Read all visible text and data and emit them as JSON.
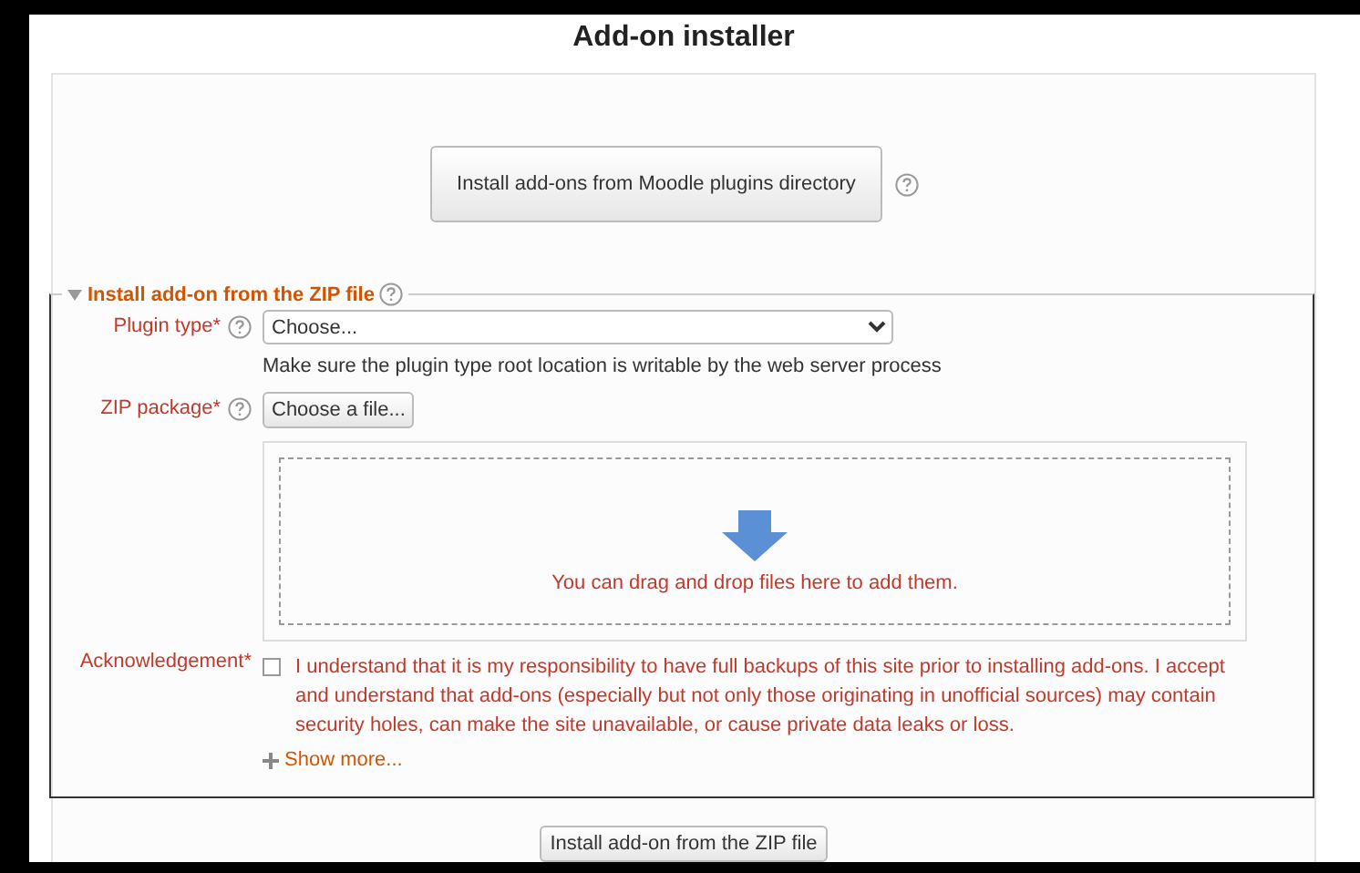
{
  "page": {
    "title": "Add-on installer"
  },
  "directory_button": {
    "label": "Install add-ons from Moodle plugins directory"
  },
  "zip_section": {
    "legend": "Install add-on from the ZIP file",
    "expanded": true,
    "plugin_type": {
      "label": "Plugin type",
      "required": "*",
      "value": "Choose...",
      "hint": "Make sure the plugin type root location is writable by the web server process"
    },
    "zip_package": {
      "label": "ZIP package",
      "required": "*",
      "button": "Choose a file...",
      "drop_text": "You can drag and drop files here to add them."
    },
    "acknowledgement": {
      "label": "Acknowledgement",
      "required": "*",
      "checked": false,
      "text": "I understand that it is my responsibility to have full backups of this site prior to installing add-ons. I accept and understand that add-ons (especially but not only those originating in unofficial sources) may contain security holes, can make the site unavailable, or cause private data leaks or loss."
    },
    "show_more": "Show more..."
  },
  "submit_button": {
    "label": "Install add-on from the ZIP file"
  }
}
